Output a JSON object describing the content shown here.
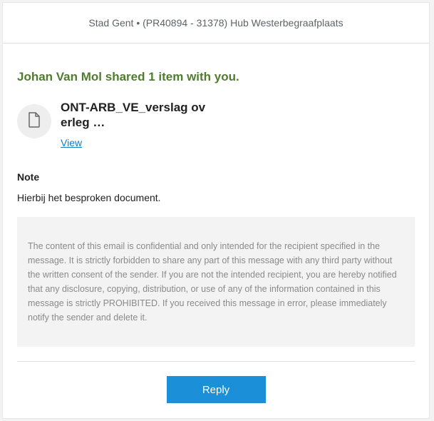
{
  "header": {
    "title": "Stad Gent • (PR40894 - 31378) Hub Westerbegraafplaats"
  },
  "message": {
    "shared_title": "Johan Van Mol shared 1 item with you.",
    "item": {
      "icon": "document-icon",
      "name": "ONT-ARB_VE_verslag ov erleg …",
      "view_label": "View"
    },
    "note_label": "Note",
    "note_text": "Hierbij het besproken document.",
    "disclaimer": "The content of this email is confidential and only intended for the recipient specified in the message. It is strictly forbidden to share any part of this message with any third party without the written consent of the sender. If you are not the intended recipient, you are hereby notified that any disclosure, copying, distribution, or use of any of the information contained in this message is strictly PROHIBITED. If you received this message in error, please immediately notify the sender and delete it.",
    "reply_label": "Reply"
  },
  "colors": {
    "title_green": "#4f7d2f",
    "link_blue": "#0f7ec4",
    "button_blue": "#1b8fd8"
  }
}
